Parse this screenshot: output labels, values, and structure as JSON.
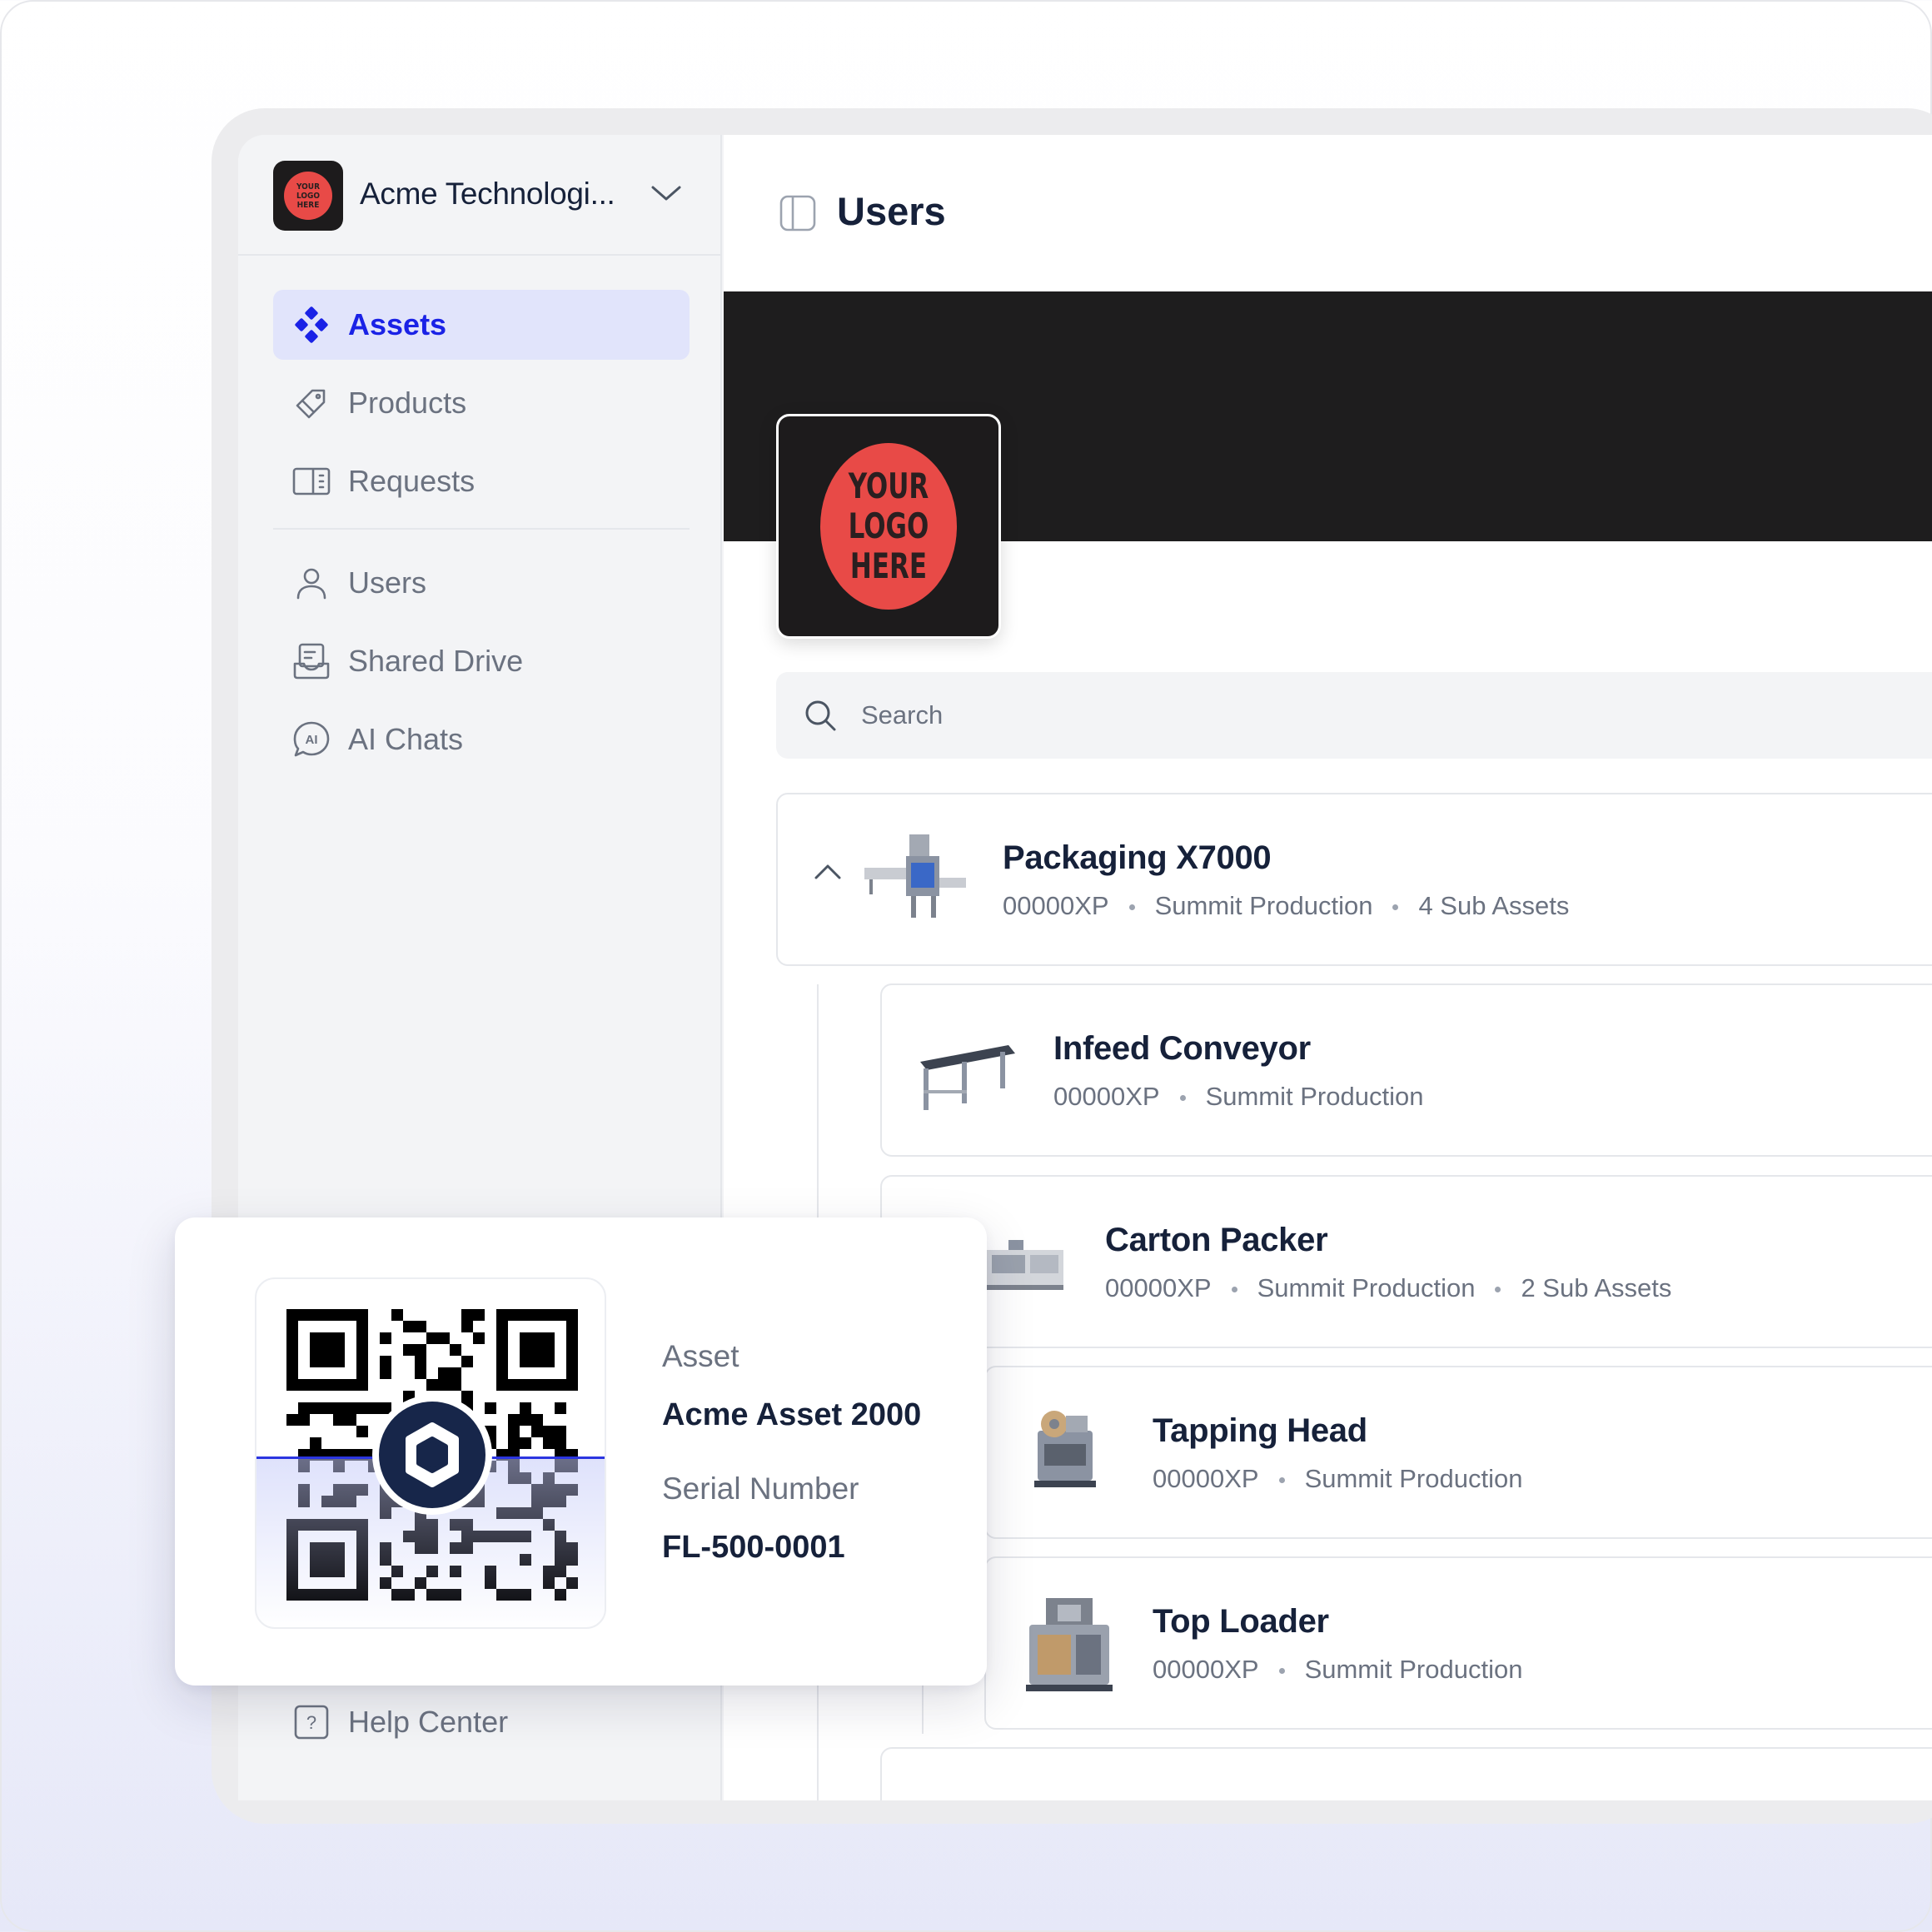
{
  "organization": {
    "name": "Acme Technologi...",
    "logo_text": [
      "YOUR",
      "LOGO",
      "HERE"
    ]
  },
  "nav": {
    "primary": [
      {
        "label": "Assets",
        "icon": "assets-icon",
        "active": true
      },
      {
        "label": "Products",
        "icon": "tag-icon",
        "active": false
      },
      {
        "label": "Requests",
        "icon": "requests-icon",
        "active": false
      }
    ],
    "secondary": [
      {
        "label": "Users",
        "icon": "user-icon"
      },
      {
        "label": "Shared Drive",
        "icon": "drive-icon"
      },
      {
        "label": "AI Chats",
        "icon": "ai-chat-icon"
      }
    ],
    "help": "Help Center"
  },
  "header": {
    "title": "Users"
  },
  "profile": {
    "logo_text": [
      "YOUR",
      "LOGO",
      "HERE"
    ]
  },
  "search": {
    "placeholder": "Search"
  },
  "assets": [
    {
      "name": "Packaging X7000",
      "code": "00000XP",
      "location": "Summit Production",
      "sub_assets": "4 Sub Assets",
      "expanded": true
    },
    {
      "name": "Infeed Conveyor",
      "code": "00000XP",
      "location": "Summit Production"
    },
    {
      "name": "Carton Packer",
      "code": "00000XP",
      "location": "Summit Production",
      "sub_assets": "2 Sub Assets"
    },
    {
      "name": "Tapping Head",
      "code": "00000XP",
      "location": "Summit Production"
    },
    {
      "name": "Top Loader",
      "code": "00000XP",
      "location": "Summit Production"
    }
  ],
  "qr_card": {
    "asset_label": "Asset",
    "asset_value": "Acme Asset 2000",
    "serial_label": "Serial Number",
    "serial_value": "FL-500-0001"
  },
  "colors": {
    "accent": "#1a22e6",
    "active_bg": "#e1e4fb",
    "text_primary": "#16213a",
    "text_muted": "#6b7280",
    "logo_red": "#e84a47"
  }
}
